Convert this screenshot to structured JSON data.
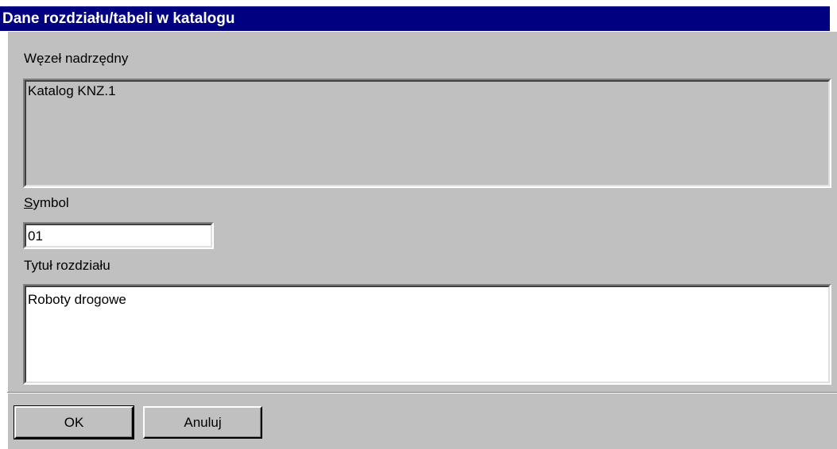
{
  "dialog": {
    "title": "Dane rozdziału/tabeli w katalogu"
  },
  "parent_node": {
    "label": "Węzeł nadrzędny",
    "value": "Katalog KNZ.1"
  },
  "symbol": {
    "label_underlined": "S",
    "label_rest": "ymbol",
    "value": "01"
  },
  "chapter_title": {
    "label": "Tytuł rozdziału",
    "value": "Roboty drogowe"
  },
  "buttons": {
    "ok_label": "OK",
    "cancel_label": "Anuluj"
  },
  "colors": {
    "titlebar": "#000080",
    "face": "#c0c0c0"
  }
}
